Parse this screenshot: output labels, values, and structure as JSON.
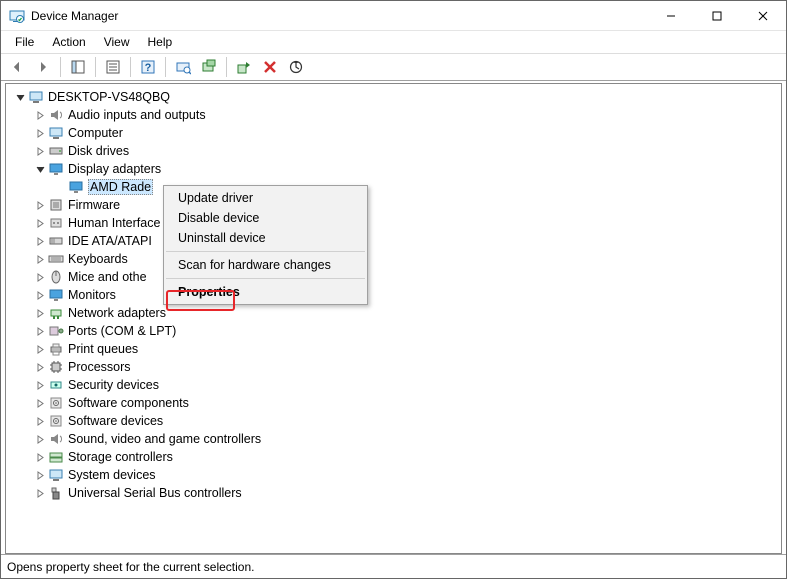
{
  "window": {
    "title": "Device Manager"
  },
  "menu": {
    "file": "File",
    "action": "Action",
    "view": "View",
    "help": "Help"
  },
  "tree": {
    "root": "DESKTOP-VS48QBQ",
    "categories": [
      "Audio inputs and outputs",
      "Computer",
      "Disk drives",
      "Display adapters",
      "Firmware",
      "Human Interface",
      "IDE ATA/ATAPI",
      "Keyboards",
      "Mice and othe",
      "Monitors",
      "Network adapters",
      "Ports (COM & LPT)",
      "Print queues",
      "Processors",
      "Security devices",
      "Software components",
      "Software devices",
      "Sound, video and game controllers",
      "Storage controllers",
      "System devices",
      "Universal Serial Bus controllers"
    ],
    "selected_device": "AMD Rade"
  },
  "context_menu": {
    "update": "Update driver",
    "disable": "Disable device",
    "uninstall": "Uninstall device",
    "scan": "Scan for hardware changes",
    "properties": "Properties"
  },
  "status": "Opens property sheet for the current selection."
}
